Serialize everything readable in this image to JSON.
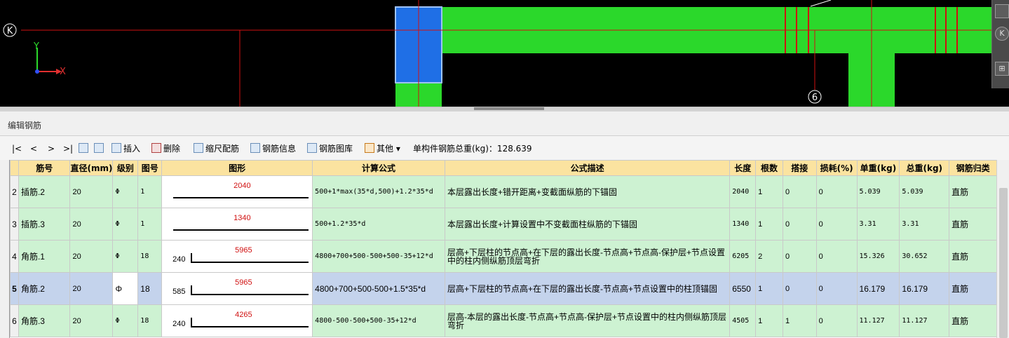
{
  "cad": {
    "axis_k_label": "K",
    "axis_6_label": "6",
    "axis_y_label": "Y",
    "axis_x_label": "X",
    "palette_right_label": "K",
    "colors": {
      "background": "#000000",
      "beam": "#2bd82b",
      "column": "#1f6fe6",
      "axis_line": "#d01010"
    }
  },
  "panel": {
    "title": "编辑钢筋"
  },
  "toolbar": {
    "nav_first": "|<",
    "nav_prev": "<",
    "nav_next": ">",
    "nav_last": ">|",
    "insert": "插入",
    "delete": "删除",
    "scale_rebar": "缩尺配筋",
    "rebar_info": "钢筋信息",
    "rebar_library": "钢筋图库",
    "other": "其他",
    "total_weight": "单构件钢筋总重(kg)：128.639"
  },
  "grid": {
    "headers": [
      "筋号",
      "直径(mm)",
      "级别",
      "图号",
      "图形",
      "计算公式",
      "公式描述",
      "长度",
      "根数",
      "搭接",
      "损耗(%)",
      "单重(kg)",
      "总重(kg)",
      "钢筋归类"
    ],
    "rows": [
      {
        "num": "2",
        "name": "插筋.2",
        "dia": "20",
        "grade": "Φ",
        "fig": "1",
        "shape_main": "2040",
        "shape_left": "",
        "formula": "500+1*max(35*d,500)+1.2*35*d",
        "desc": "本层露出长度+错开距离+变截面纵筋的下锚固",
        "length": "2040",
        "count": "1",
        "lap": "0",
        "loss": "0",
        "unit_w": "5.039",
        "total_w": "5.039",
        "cat": "直筋"
      },
      {
        "num": "3",
        "name": "插筋.3",
        "dia": "20",
        "grade": "Φ",
        "fig": "1",
        "shape_main": "1340",
        "shape_left": "",
        "formula": "500+1.2*35*d",
        "desc": "本层露出长度+计算设置中不变截面柱纵筋的下锚固",
        "length": "1340",
        "count": "1",
        "lap": "0",
        "loss": "0",
        "unit_w": "3.31",
        "total_w": "3.31",
        "cat": "直筋"
      },
      {
        "num": "4",
        "name": "角筋.1",
        "dia": "20",
        "grade": "Φ",
        "fig": "18",
        "shape_main": "5965",
        "shape_left": "240",
        "formula": "4800+700+500-500+500-35+12*d",
        "desc": "层高+下层柱的节点高+在下层的露出长度-节点高+节点高-保护层+节点设置中的柱内侧纵筋顶层弯折",
        "length": "6205",
        "count": "2",
        "lap": "0",
        "loss": "0",
        "unit_w": "15.326",
        "total_w": "30.652",
        "cat": "直筋"
      },
      {
        "num": "5",
        "name": "角筋.2",
        "dia": "20",
        "grade": "Φ",
        "fig": "18",
        "shape_main": "5965",
        "shape_left": "585",
        "formula": "4800+700+500-500+1.5*35*d",
        "desc": "层高+下层柱的节点高+在下层的露出长度-节点高+节点设置中的柱顶锚固",
        "length": "6550",
        "count": "1",
        "lap": "0",
        "loss": "0",
        "unit_w": "16.179",
        "total_w": "16.179",
        "cat": "直筋"
      },
      {
        "num": "6",
        "name": "角筋.3",
        "dia": "20",
        "grade": "Φ",
        "fig": "18",
        "shape_main": "4265",
        "shape_left": "240",
        "formula": "4800-500-500+500-35+12*d",
        "desc": "层高-本层的露出长度-节点高+节点高-保护层+节点设置中的柱内侧纵筋顶层弯折",
        "length": "4505",
        "count": "1",
        "lap": "1",
        "loss": "0",
        "unit_w": "11.127",
        "total_w": "11.127",
        "cat": "直筋"
      }
    ],
    "selected_row": "5"
  }
}
